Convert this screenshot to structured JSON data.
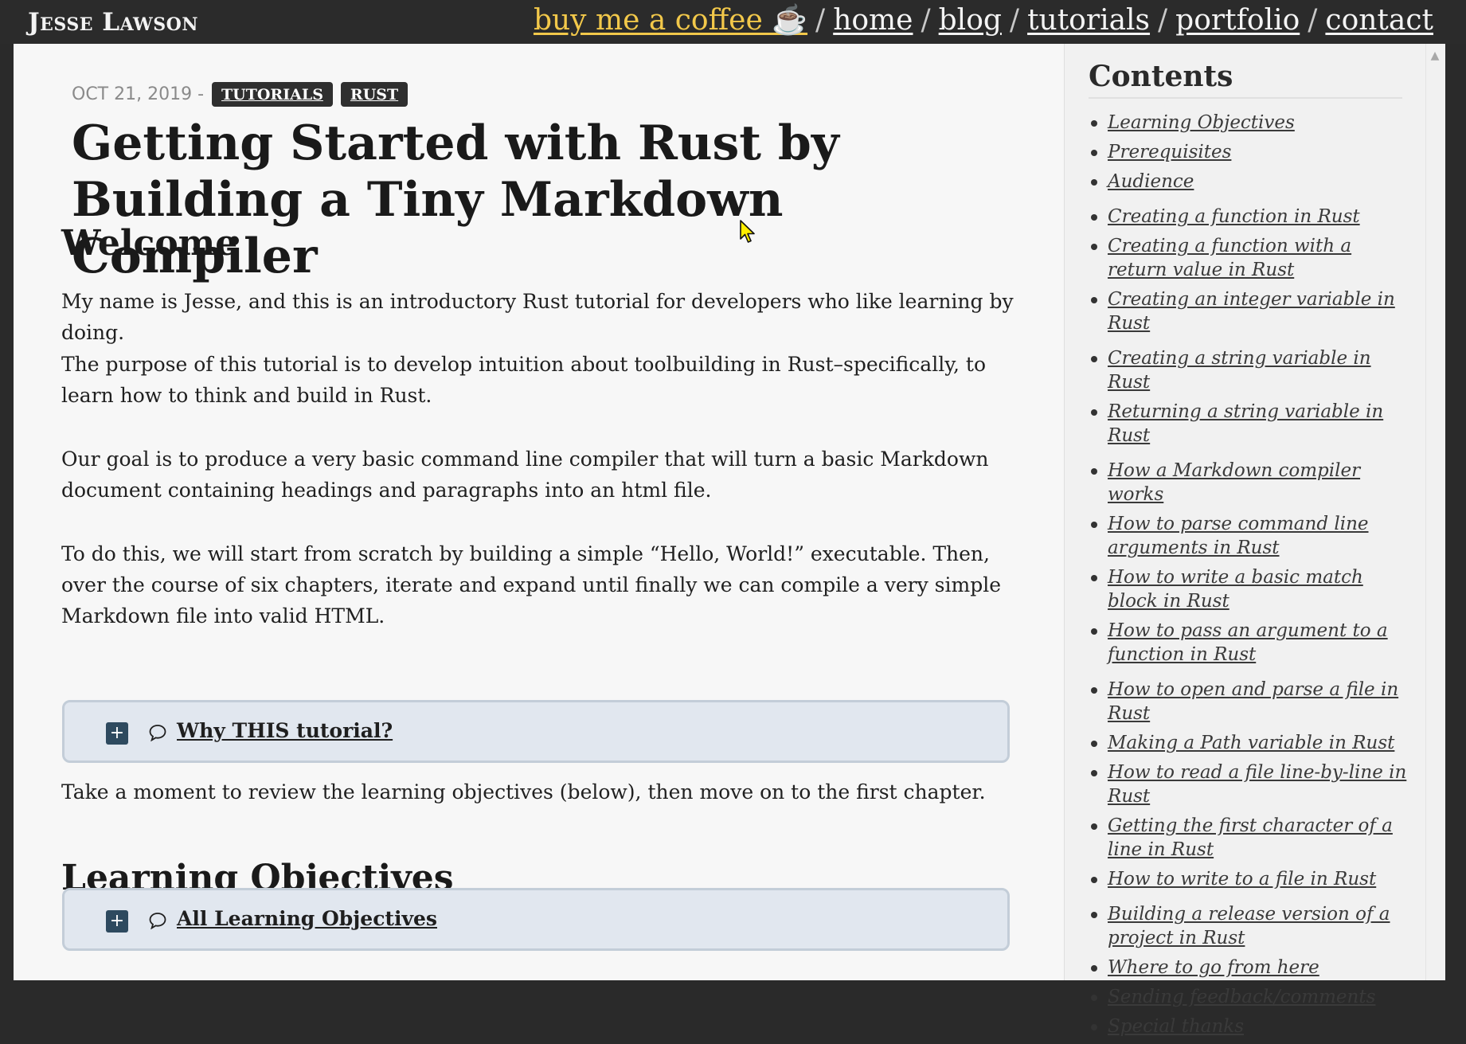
{
  "header": {
    "brand": "Jesse Lawson",
    "nav": {
      "coffee": "buy me a coffee ☕",
      "separator": "/",
      "home": "home",
      "blog": "blog",
      "tutorials": "tutorials",
      "portfolio": "portfolio",
      "contact": "contact"
    }
  },
  "post": {
    "date": "OCT 21, 2019 -",
    "tags": [
      "TUTORIALS",
      "RUST"
    ],
    "title": "Getting Started with Rust by Building a Tiny Markdown Compiler",
    "welcome_heading": "Welcome",
    "paragraphs": [
      "My name is Jesse, and this is an introductory Rust tutorial for developers who like learning by doing.",
      "The purpose of this tutorial is to develop intuition about toolbuilding in Rust–specifically, to learn how to think and build in Rust.",
      "Our goal is to produce a very basic command line compiler that will turn a basic Markdown document containing headings and paragraphs into an html file.",
      "To do this, we will start from scratch by building a simple “Hello, World!” executable. Then, over the course of six chapters, iterate and expand until finally we can compile a very simple Markdown file into valid HTML."
    ],
    "why_summary": "Why THIS tutorial?",
    "review_text": "Take a moment to review the learning objectives (below), then move on to the first chapter.",
    "objectives_heading": "Learning Objectives",
    "objectives_summary": "All Learning Objectives",
    "expand_symbol": "+"
  },
  "sidebar": {
    "title": "Contents",
    "items": [
      "Learning Objectives",
      "Prerequisites",
      "Audience",
      "Creating a function in Rust",
      "Creating a function with a return value in Rust",
      "Creating an integer variable in Rust",
      "Creating a string variable in Rust",
      "Returning a string variable in Rust",
      "How a Markdown compiler works",
      "How to parse command line arguments in Rust",
      "How to write a basic match block in Rust",
      "How to pass an argument to a function in Rust",
      "How to open and parse a file in Rust",
      "Making a Path variable in Rust",
      "How to read a file line-by-line in Rust",
      "Getting the first character of a line in Rust",
      "How to write to a file in Rust",
      "Building a release version of a project in Rust",
      "Where to go from here",
      "Sending feedback/comments",
      "Special thanks"
    ]
  },
  "icons": {
    "expand": "plus-icon",
    "comment": "speech-bubble-icon",
    "scroll_up": "chevron-up-icon",
    "cursor": "mouse-pointer-icon"
  },
  "colors": {
    "topbar": "#2b2b2b",
    "coffee_link": "#f2c84a",
    "details_bg": "#e1e7ef",
    "plus_button": "#2e4a5f"
  }
}
